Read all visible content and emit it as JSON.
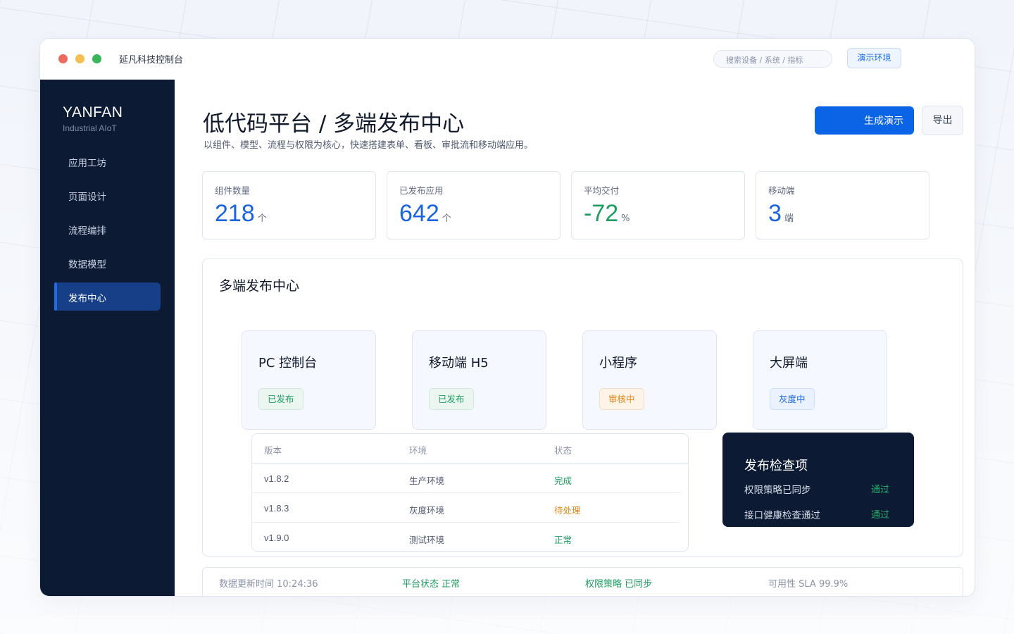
{
  "window": {
    "app_title": "延凡科技控制台",
    "search_placeholder": "搜索设备 / 系统 / 指标",
    "env_button": "演示环境"
  },
  "sidebar": {
    "brand": "YANFAN",
    "brand_sub": "Industrial AIoT",
    "items": [
      {
        "label": "应用工坊",
        "active": false
      },
      {
        "label": "页面设计",
        "active": false
      },
      {
        "label": "流程编排",
        "active": false
      },
      {
        "label": "数据模型",
        "active": false
      },
      {
        "label": "发布中心",
        "active": true
      }
    ]
  },
  "header": {
    "title": "低代码平台 / 多端发布中心",
    "subtitle": "以组件、模型、流程与权限为核心，快速搭建表单、看板、审批流和移动端应用。",
    "primary_button": "生成演示",
    "secondary_button": "导出"
  },
  "stats": [
    {
      "label": "组件数量",
      "value": "218",
      "unit": "个",
      "color": "#1b64e0"
    },
    {
      "label": "已发布应用",
      "value": "642",
      "unit": "个",
      "color": "#1b64e0"
    },
    {
      "label": "平均交付",
      "value": "-72",
      "unit": "%",
      "color": "#1f9d61"
    },
    {
      "label": "移动端",
      "value": "3",
      "unit": "端",
      "color": "#1b64e0"
    }
  ],
  "panel": {
    "title": "多端发布中心",
    "channels": [
      {
        "name": "PC 控制台",
        "status": "已发布",
        "status_color": "#1f9d61"
      },
      {
        "name": "移动端 H5",
        "status": "已发布",
        "status_color": "#1f9d61"
      },
      {
        "name": "小程序",
        "status": "审核中",
        "status_color": "#e4861a"
      },
      {
        "name": "大屏端",
        "status": "灰度中",
        "status_color": "#1b64e0"
      }
    ],
    "table": {
      "headers": [
        "版本",
        "环境",
        "状态"
      ],
      "rows": [
        {
          "version": "v1.8.2",
          "env": "生产环境",
          "status": "完成"
        },
        {
          "version": "v1.8.3",
          "env": "灰度环境",
          "status": "待处理"
        },
        {
          "version": "v1.9.0",
          "env": "测试环境",
          "status": "正常"
        }
      ]
    },
    "checks": {
      "title": "发布检查项",
      "items": [
        {
          "label": "权限策略已同步",
          "result": "通过"
        },
        {
          "label": "接口健康检查通过",
          "result": "通过"
        }
      ]
    }
  },
  "statusbar": {
    "updated": "数据更新时间 10:24:36",
    "platform": "平台状态 正常",
    "permission": "权限策略 已同步",
    "sla": "可用性 SLA 99.9%"
  }
}
